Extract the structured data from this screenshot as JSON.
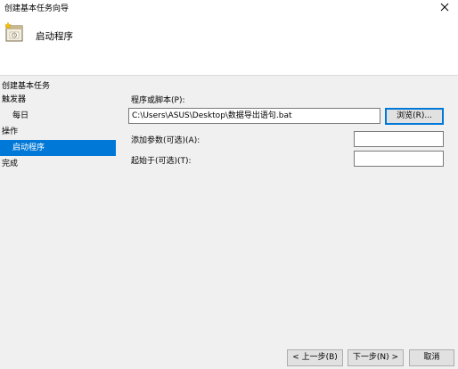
{
  "window": {
    "title": "创建基本任务向导"
  },
  "header": {
    "step_title": "启动程序",
    "icon": "wizard-calendar-icon"
  },
  "sidebar": {
    "heading": "创建基本任务",
    "items": [
      {
        "label": "触发器",
        "level": 0,
        "selected": false
      },
      {
        "label": "每日",
        "level": 1,
        "selected": false
      },
      {
        "label": "操作",
        "level": 0,
        "selected": false
      },
      {
        "label": "启动程序",
        "level": 1,
        "selected": true
      },
      {
        "label": "完成",
        "level": 0,
        "selected": false
      }
    ]
  },
  "form": {
    "program_label": "程序或脚本(P):",
    "program_value": "C:\\Users\\ASUS\\Desktop\\数据导出语句.bat",
    "browse_label": "浏览(R)...",
    "args_label": "添加参数(可选)(A):",
    "args_value": "",
    "start_label": "起始于(可选)(T):",
    "start_value": ""
  },
  "footer": {
    "back_label": "< 上一步(B)",
    "next_label": "下一步(N) >",
    "cancel_label": "取消"
  },
  "colors": {
    "selection": "#0078d7",
    "body_bg": "#f0f0f0"
  }
}
